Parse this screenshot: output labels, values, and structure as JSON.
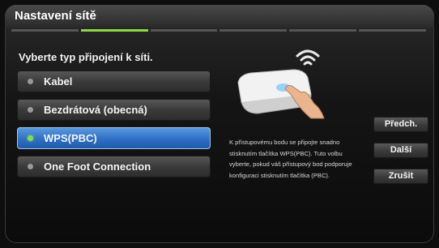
{
  "window": {
    "title": "Nastavení sítě"
  },
  "progress": {
    "total_steps": 6,
    "current_step": 2
  },
  "prompt": "Vyberte typ připojení k síti.",
  "options": [
    {
      "label": "Kabel",
      "selected": false
    },
    {
      "label": "Bezdrátová (obecná)",
      "selected": false
    },
    {
      "label": "WPS(PBC)",
      "selected": true
    },
    {
      "label": "One Foot Connection",
      "selected": false
    }
  ],
  "description": "K přístupovému bodu se připojte snadno stisknutím tlačítka WPS(PBC). Tuto volbu vyberte, pokud váš přístupový bod podporuje konfiguraci stisknutím tlačítka (PBC).",
  "buttons": {
    "prev": "Předch.",
    "next": "Další",
    "cancel": "Zrušit"
  },
  "colors": {
    "accent": "#8fd64a",
    "selected": "#2f6fc4"
  },
  "icons": {
    "illustration": "router-with-hand-press-icon"
  }
}
